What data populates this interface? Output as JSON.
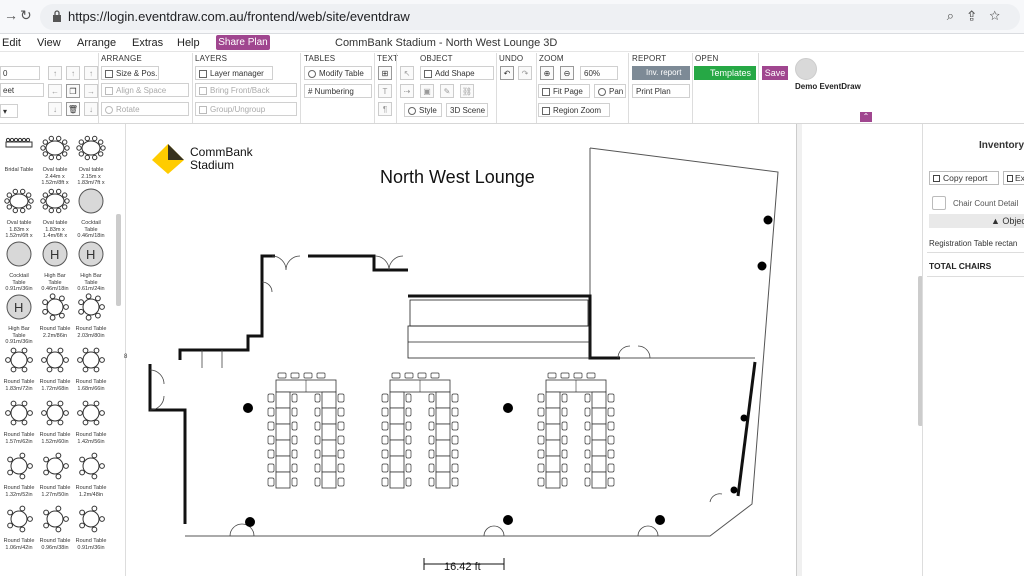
{
  "browser": {
    "url": "https://login.eventdraw.com.au/frontend/web/site/eventdraw"
  },
  "menu": {
    "items": [
      "Edit",
      "View",
      "Arrange",
      "Extras",
      "Help"
    ],
    "share_label": "Share Plan",
    "title": "CommBank Stadium - North West Lounge 3D"
  },
  "ribbon": {
    "arrange": {
      "title": "ARRANGE",
      "size_pos": "Size & Pos.",
      "align_space": "Align & Space",
      "rotate": "Rotate"
    },
    "layers": {
      "title": "LAYERS",
      "layer_manager": "Layer manager",
      "bring_front": "Bring Front/Back",
      "group": "Group/Ungroup"
    },
    "tables": {
      "title": "TABLES",
      "modify_table": "Modify Table",
      "numbering": "# Numbering"
    },
    "text": {
      "title": "TEXT"
    },
    "object": {
      "title": "OBJECT",
      "add_shape": "Add Shape",
      "style": "Style",
      "scene_3d": "3D Scene"
    },
    "undo": {
      "title": "UNDO"
    },
    "zoom": {
      "title": "ZOOM",
      "level": "60%",
      "fit_page": "Fit Page",
      "pan": "Pan",
      "region_zoom": "Region Zoom"
    },
    "report": {
      "title": "REPORT",
      "inv_report": "Inv. report",
      "print_plan": "Print Plan"
    },
    "open": {
      "title": "OPEN",
      "templates": "Templates"
    },
    "save": "Save",
    "user": "Demo EventDraw",
    "left_value": "0",
    "left_select": "eet"
  },
  "library": {
    "items": [
      {
        "label": "Bridal Table",
        "shape": "bridal"
      },
      {
        "label": "Oval table 2.44m x 1.52m/8ft x",
        "shape": "oval"
      },
      {
        "label": "Oval table 2.15m x 1.83m/7ft x",
        "shape": "oval"
      },
      {
        "label": "Oval table 1.83m x 1.52m/6ft x",
        "shape": "oval"
      },
      {
        "label": "Oval table 1.83m x 1.4m/6ft x",
        "shape": "oval"
      },
      {
        "label": "Cocktail Table 0.46m/18in",
        "shape": "cocktail"
      },
      {
        "label": "Cocktail Table 0.91m/36in",
        "shape": "cocktail"
      },
      {
        "label": "High Bar Table 0.46m/18in",
        "shape": "highbar",
        "glyph": "H"
      },
      {
        "label": "High Bar Table 0.61m/24in",
        "shape": "highbar",
        "glyph": "H"
      },
      {
        "label": "High Bar Table 0.91m/36in",
        "shape": "highbar",
        "glyph": "H"
      },
      {
        "label": "Round Table 2.2m/86in",
        "shape": "round"
      },
      {
        "label": "Round Table 2.03m/80in",
        "shape": "round"
      },
      {
        "label": "Round Table 1.83m/72in",
        "shape": "round"
      },
      {
        "label": "Round Table 1.72m/68in",
        "shape": "round"
      },
      {
        "label": "Round Table 1.68m/66in",
        "shape": "round"
      },
      {
        "label": "Round Table 1.57m/62in",
        "shape": "round"
      },
      {
        "label": "Round Table 1.52m/60in",
        "shape": "round"
      },
      {
        "label": "Round Table 1.42m/56in",
        "shape": "round"
      },
      {
        "label": "Round Table 1.32m/52in",
        "shape": "round"
      },
      {
        "label": "Round Table 1.27m/50in",
        "shape": "round"
      },
      {
        "label": "Round Table 1.2m/48in",
        "shape": "round"
      },
      {
        "label": "Round Table 1.06m/42in",
        "shape": "round"
      },
      {
        "label": "Round Table 0.96m/38in",
        "shape": "round"
      },
      {
        "label": "Round Table 0.91m/36in",
        "shape": "round"
      }
    ]
  },
  "canvas": {
    "logo_text_1": "CommBank",
    "logo_text_2": "Stadium",
    "room_title": "North West Lounge",
    "scale_label": "16.42 ft",
    "ruler_mark": "8"
  },
  "inventory": {
    "title": "Inventory",
    "copy_report": "Copy report",
    "export_label": "Ex",
    "chair_count_detail": "Chair Count Detail",
    "object_header": "▲ Object",
    "registration_row": "Registration Table rectan",
    "total_chairs": "TOTAL CHAIRS"
  },
  "colors": {
    "brand": "#a0468f",
    "templates_green": "#26a845",
    "inv_grey": "#7d8a96",
    "logo_yellow": "#ffcc00"
  }
}
